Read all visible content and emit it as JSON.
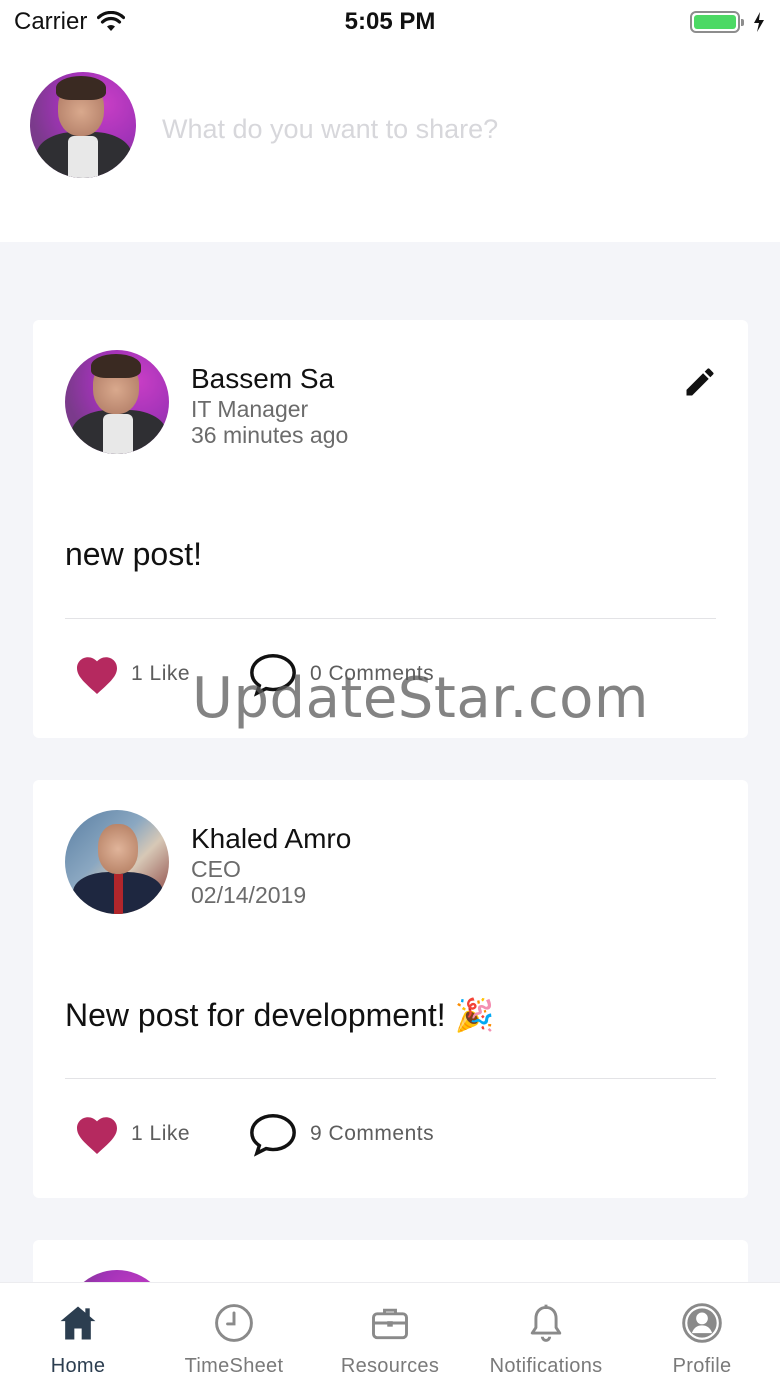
{
  "status_bar": {
    "carrier": "Carrier",
    "time": "5:05 PM"
  },
  "composer": {
    "placeholder": "What do you want to share?"
  },
  "posts": [
    {
      "author": "Bassem Sa",
      "role": "IT Manager",
      "time": "36 minutes ago",
      "text": "new post!",
      "likes_label": "1 Like",
      "comments_label": "0 Comments",
      "editable": true
    },
    {
      "author": "Khaled Amro",
      "role": "CEO",
      "time": "02/14/2019",
      "text": "New post for development! 🎉",
      "likes_label": "1 Like",
      "comments_label": "9 Comments",
      "editable": false
    }
  ],
  "watermark": "UpdateStar.com",
  "tabs": [
    {
      "label": "Home",
      "icon": "home-icon",
      "active": true
    },
    {
      "label": "TimeSheet",
      "icon": "clock-icon",
      "active": false
    },
    {
      "label": "Resources",
      "icon": "briefcase-icon",
      "active": false
    },
    {
      "label": "Notifications",
      "icon": "bell-icon",
      "active": false
    },
    {
      "label": "Profile",
      "icon": "user-circle-icon",
      "active": false
    }
  ],
  "colors": {
    "heart": "#b5295f",
    "active_tab": "#2c3e50",
    "battery": "#4cd964"
  }
}
